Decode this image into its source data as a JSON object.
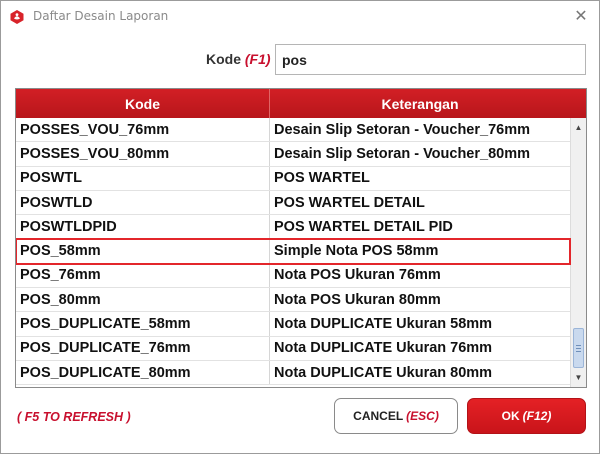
{
  "window": {
    "title": "Daftar Desain Laporan",
    "close_glyph": "✕",
    "icon": "app-logo-icon"
  },
  "search": {
    "label": "Kode",
    "shortcut": "(F1)",
    "value": "pos"
  },
  "table": {
    "columns": [
      "Kode",
      "Keterangan"
    ],
    "rows": [
      {
        "kode": "POSSES_VOU_76mm",
        "ket": "Desain Slip Setoran - Voucher_76mm"
      },
      {
        "kode": "POSSES_VOU_80mm",
        "ket": "Desain Slip Setoran - Voucher_80mm"
      },
      {
        "kode": "POSWTL",
        "ket": "POS WARTEL"
      },
      {
        "kode": "POSWTLD",
        "ket": "POS WARTEL DETAIL"
      },
      {
        "kode": "POSWTLDPID",
        "ket": "POS WARTEL DETAIL PID"
      },
      {
        "kode": "POS_58mm",
        "ket": "Simple Nota POS 58mm"
      },
      {
        "kode": "POS_76mm",
        "ket": "Nota POS Ukuran 76mm"
      },
      {
        "kode": "POS_80mm",
        "ket": "Nota POS Ukuran 80mm"
      },
      {
        "kode": "POS_DUPLICATE_58mm",
        "ket": "Nota DUPLICATE Ukuran 58mm"
      },
      {
        "kode": "POS_DUPLICATE_76mm",
        "ket": "Nota DUPLICATE Ukuran 76mm"
      },
      {
        "kode": "POS_DUPLICATE_80mm",
        "ket": "Nota DUPLICATE Ukuran 80mm"
      }
    ],
    "highlighted_row": 5
  },
  "footer": {
    "refresh_hint": "( F5 TO REFRESH )",
    "cancel_label": "CANCEL",
    "cancel_shortcut": "(ESC)",
    "ok_label": "OK",
    "ok_shortcut": "(F12)"
  },
  "colors": {
    "accent": "#c8102e",
    "header_bg": "#c8161b",
    "highlight_border": "#e3262b"
  }
}
